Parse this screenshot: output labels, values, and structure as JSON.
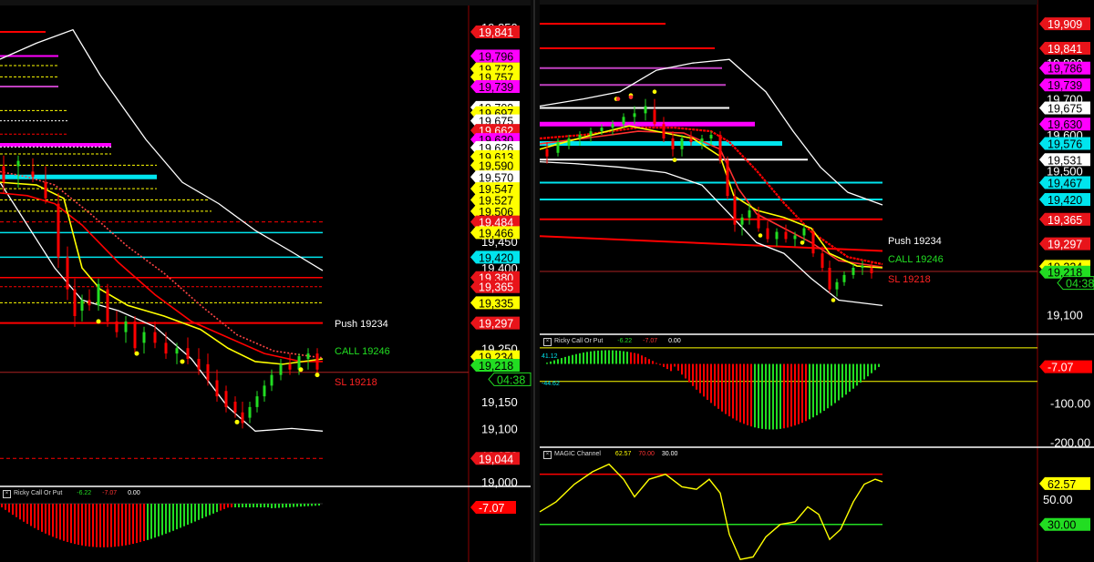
{
  "colors": {
    "background": "#000000",
    "red_line": "#ff0000",
    "magenta": "#ff00ff",
    "purple": "#c040c0",
    "cyan": "#00e5ee",
    "yellow": "#ffff00",
    "white": "#ffffff",
    "green": "#22dd22",
    "separator": "#8b0000"
  },
  "chart_data": [
    {
      "type": "candlestick",
      "panel": "left-main",
      "ylim": [
        18990,
        19870
      ],
      "axis_ticks": [
        "19,850",
        "19,800",
        "19,700",
        "19,600",
        "19,500",
        "19,450",
        "19,400",
        "19,250",
        "19,150",
        "19,100",
        "19,050",
        "19,000"
      ],
      "price_labels": [
        {
          "text": "19,841",
          "value": 19841,
          "color": "#e8141a",
          "fg": "#ffffff"
        },
        {
          "text": "19,796",
          "value": 19796,
          "color": "#ff00ff",
          "fg": "#000000"
        },
        {
          "text": "19,772",
          "value": 19772,
          "color": "#ffff00",
          "fg": "#000000"
        },
        {
          "text": "19,757",
          "value": 19757,
          "color": "#ffff00",
          "fg": "#000000"
        },
        {
          "text": "19,739",
          "value": 19739,
          "color": "#ff00ff",
          "fg": "#000000"
        },
        {
          "text": "19,700",
          "value": 19700,
          "color": "#ffffff",
          "fg": "#000000"
        },
        {
          "text": "19,697",
          "value": 19690,
          "color": "#ffff00",
          "fg": "#000000"
        },
        {
          "text": "19,675",
          "value": 19675,
          "color": "#ffffff",
          "fg": "#000000"
        },
        {
          "text": "19,662",
          "value": 19657,
          "color": "#e8141a",
          "fg": "#ffffff"
        },
        {
          "text": "19,630",
          "value": 19640,
          "color": "#ff00ff",
          "fg": "#000000"
        },
        {
          "text": "19,626",
          "value": 19625,
          "color": "#ffffff",
          "fg": "#000000"
        },
        {
          "text": "19,613",
          "value": 19608,
          "color": "#ffff00",
          "fg": "#000000"
        },
        {
          "text": "19,590",
          "value": 19592,
          "color": "#ffff00",
          "fg": "#000000"
        },
        {
          "text": "19,570",
          "value": 19570,
          "color": "#ffffff",
          "fg": "#000000"
        },
        {
          "text": "19,547",
          "value": 19548,
          "color": "#ffff00",
          "fg": "#000000"
        },
        {
          "text": "19,527",
          "value": 19527,
          "color": "#ffff00",
          "fg": "#000000"
        },
        {
          "text": "19,506",
          "value": 19506,
          "color": "#ffff00",
          "fg": "#000000"
        },
        {
          "text": "19,484",
          "value": 19486,
          "color": "#e8141a",
          "fg": "#ffffff"
        },
        {
          "text": "19,466",
          "value": 19466,
          "color": "#ffff00",
          "fg": "#000000"
        },
        {
          "text": "19,420",
          "value": 19420,
          "color": "#00e5ee",
          "fg": "#000000"
        },
        {
          "text": "19,380",
          "value": 19382,
          "color": "#e8141a",
          "fg": "#ffffff"
        },
        {
          "text": "19,365",
          "value": 19365,
          "color": "#e8141a",
          "fg": "#ffffff"
        },
        {
          "text": "19,335",
          "value": 19335,
          "color": "#ffff00",
          "fg": "#000000"
        },
        {
          "text": "19,297",
          "value": 19297,
          "color": "#e8141a",
          "fg": "#ffffff"
        },
        {
          "text": "19,234",
          "value": 19234,
          "color": "#ffff00",
          "fg": "#000000"
        },
        {
          "text": "19,218",
          "value": 19218,
          "color": "#22dd22",
          "fg": "#000000"
        },
        {
          "text": "04:38",
          "value": 19192,
          "color": "#000000",
          "fg": "#22dd22",
          "border": "#22dd22"
        },
        {
          "text": "19,044",
          "value": 19044,
          "color": "#e8141a",
          "fg": "#ffffff"
        }
      ],
      "annotations": [
        {
          "text": "Push  19234",
          "color": "#ffffff"
        },
        {
          "text": "CALL 19246",
          "color": "#22dd22"
        },
        {
          "text": "SL 19218",
          "color": "#ff2222"
        }
      ]
    },
    {
      "type": "bar",
      "panel": "left-indicator",
      "title": "Ricky Call Or Put",
      "values_text": [
        "-6.22",
        "-7.07",
        "0.00"
      ],
      "value_label": {
        "text": "-7.07",
        "value": -7.07
      }
    },
    {
      "type": "candlestick",
      "panel": "right-main",
      "ylim": [
        19050,
        19950
      ],
      "axis_ticks": [
        "19,800",
        "19,700",
        "19,600",
        "19,500",
        "19,100"
      ],
      "price_labels": [
        {
          "text": "19,909",
          "value": 19909,
          "color": "#e8141a",
          "fg": "#ffffff"
        },
        {
          "text": "19,841",
          "value": 19841,
          "color": "#e8141a",
          "fg": "#ffffff"
        },
        {
          "text": "19,786",
          "value": 19786,
          "color": "#ff00ff",
          "fg": "#000000"
        },
        {
          "text": "19,739",
          "value": 19739,
          "color": "#ff00ff",
          "fg": "#000000"
        },
        {
          "text": "19,675",
          "value": 19675,
          "color": "#ffffff",
          "fg": "#000000"
        },
        {
          "text": "19,630",
          "value": 19630,
          "color": "#ff00ff",
          "fg": "#000000"
        },
        {
          "text": "19,576",
          "value": 19576,
          "color": "#00e5ee",
          "fg": "#000000"
        },
        {
          "text": "19,531",
          "value": 19531,
          "color": "#ffffff",
          "fg": "#000000"
        },
        {
          "text": "19,467",
          "value": 19467,
          "color": "#00e5ee",
          "fg": "#000000"
        },
        {
          "text": "19,420",
          "value": 19420,
          "color": "#00e5ee",
          "fg": "#000000"
        },
        {
          "text": "19,365",
          "value": 19365,
          "color": "#e8141a",
          "fg": "#ffffff"
        },
        {
          "text": "19,297",
          "value": 19297,
          "color": "#e8141a",
          "fg": "#ffffff"
        },
        {
          "text": "19,234",
          "value": 19234,
          "color": "#ffff00",
          "fg": "#000000"
        },
        {
          "text": "19,218",
          "value": 19218,
          "color": "#22dd22",
          "fg": "#000000"
        },
        {
          "text": "04:38",
          "value": 19188,
          "color": "#000000",
          "fg": "#22dd22",
          "border": "#22dd22"
        }
      ],
      "annotations": [
        {
          "text": "Push  19234",
          "color": "#ffffff"
        },
        {
          "text": "CALL 19246",
          "color": "#22dd22"
        },
        {
          "text": "SL 19218",
          "color": "#ff2222"
        }
      ]
    },
    {
      "type": "bar",
      "panel": "right-indicator-1",
      "title": "Ricky Call Or Put",
      "values_text": [
        "-6.22",
        "-7.07",
        "0.00"
      ],
      "level_labels": [
        "41.12",
        "-44.62"
      ],
      "ylim": [
        -210,
        50
      ],
      "axis_ticks": [
        "-100.00",
        "-200.00"
      ],
      "value_label": {
        "text": "-7.07",
        "value": -7.07
      }
    },
    {
      "type": "line",
      "panel": "right-indicator-2",
      "title": "MAGIC Channel",
      "values_text": [
        "62.57",
        "70.00",
        "30.00"
      ],
      "levels": [
        70,
        30
      ],
      "ylim": [
        0,
        85
      ],
      "axis_ticks": [
        "50.00"
      ],
      "value_labels": [
        {
          "text": "62.57",
          "value": 62.57,
          "color": "#ffff00"
        },
        {
          "text": "30.00",
          "value": 30,
          "color": "#22dd22"
        }
      ]
    }
  ]
}
